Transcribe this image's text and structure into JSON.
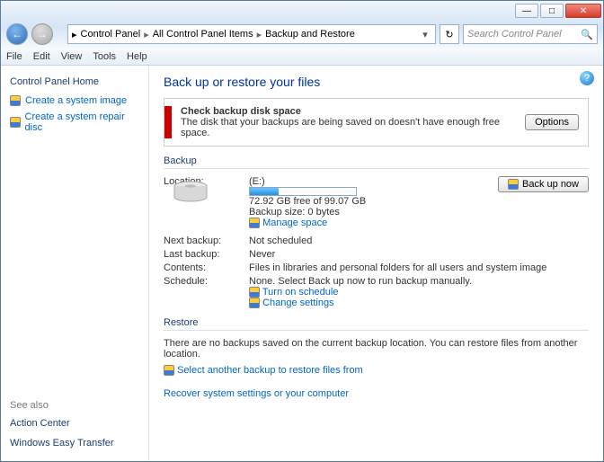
{
  "titlebar": {
    "min": "—",
    "max": "□",
    "close": "✕"
  },
  "nav": {
    "back": "←",
    "forward": "→",
    "crumbs": [
      "Control Panel",
      "All Control Panel Items",
      "Backup and Restore"
    ],
    "refresh": "↻",
    "search_placeholder": "Search Control Panel"
  },
  "menu": [
    "File",
    "Edit",
    "View",
    "Tools",
    "Help"
  ],
  "sidebar": {
    "home": "Control Panel Home",
    "links": [
      "Create a system image",
      "Create a system repair disc"
    ],
    "see_also_label": "See also",
    "see_also": [
      "Action Center",
      "Windows Easy Transfer"
    ]
  },
  "main": {
    "title": "Back up or restore your files",
    "warning": {
      "title": "Check backup disk space",
      "text": "The disk that your backups are being saved on doesn't have enough free space.",
      "options": "Options"
    },
    "backup_section": "Backup",
    "backup": {
      "location_label": "Location:",
      "location_value": "(E:)",
      "free_text": "72.92 GB free of 99.07 GB",
      "progress_pct": 27,
      "size_text": "Backup size: 0 bytes",
      "manage": "Manage space",
      "backup_now": "Back up now",
      "next_label": "Next backup:",
      "next_value": "Not scheduled",
      "last_label": "Last backup:",
      "last_value": "Never",
      "contents_label": "Contents:",
      "contents_value": "Files in libraries and personal folders for all users and system image",
      "schedule_label": "Schedule:",
      "schedule_value": "None. Select Back up now to run backup manually.",
      "turn_on": "Turn on schedule",
      "change": "Change settings"
    },
    "restore_section": "Restore",
    "restore": {
      "text": "There are no backups saved on the current backup location. You can restore files from another location.",
      "select": "Select another backup to restore files from",
      "recover": "Recover system settings or your computer"
    }
  }
}
